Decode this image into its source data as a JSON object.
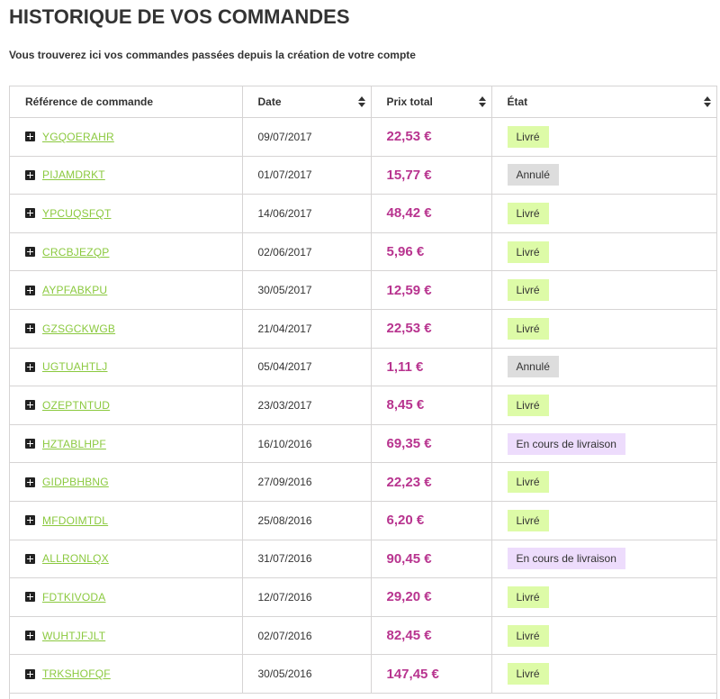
{
  "page": {
    "title": "HISTORIQUE DE VOS COMMANDES",
    "subtitle": "Vous trouverez ici vos commandes passées depuis la création de votre compte"
  },
  "table": {
    "headers": [
      "Référence de commande",
      "Date",
      "Prix total",
      "État"
    ],
    "rows": [
      {
        "ref": "YGQOERAHR",
        "date": "09/07/2017",
        "price": "22,53 €",
        "state": "Livré",
        "state_color": "#ddfba7"
      },
      {
        "ref": "PIJAMDRKT",
        "date": "01/07/2017",
        "price": "15,77 €",
        "state": "Annulé",
        "state_color": "#dddddd"
      },
      {
        "ref": "YPCUQSFQT",
        "date": "14/06/2017",
        "price": "48,42 €",
        "state": "Livré",
        "state_color": "#ddfba7"
      },
      {
        "ref": "CRCBJEZQP",
        "date": "02/06/2017",
        "price": "5,96 €",
        "state": "Livré",
        "state_color": "#ddfba7"
      },
      {
        "ref": "AYPFABKPU",
        "date": "30/05/2017",
        "price": "12,59 €",
        "state": "Livré",
        "state_color": "#ddfba7"
      },
      {
        "ref": "GZSGCKWGB",
        "date": "21/04/2017",
        "price": "22,53 €",
        "state": "Livré",
        "state_color": "#ddfba7"
      },
      {
        "ref": "UGTUAHTLJ",
        "date": "05/04/2017",
        "price": "1,11 €",
        "state": "Annulé",
        "state_color": "#dddddd"
      },
      {
        "ref": "OZEPTNTUD",
        "date": "23/03/2017",
        "price": "8,45 €",
        "state": "Livré",
        "state_color": "#ddfba7"
      },
      {
        "ref": "HZTABLHPF",
        "date": "16/10/2016",
        "price": "69,35 €",
        "state": "En cours de livraison",
        "state_color": "#eddcfc"
      },
      {
        "ref": "GIDPBHBNG",
        "date": "27/09/2016",
        "price": "22,23 €",
        "state": "Livré",
        "state_color": "#ddfba7"
      },
      {
        "ref": "MFDOIMTDL",
        "date": "25/08/2016",
        "price": "6,20 €",
        "state": "Livré",
        "state_color": "#ddfba7"
      },
      {
        "ref": "ALLRONLQX",
        "date": "31/07/2016",
        "price": "90,45 €",
        "state": "En cours de livraison",
        "state_color": "#eddcfc"
      },
      {
        "ref": "FDTKIVODA",
        "date": "12/07/2016",
        "price": "29,20 €",
        "state": "Livré",
        "state_color": "#ddfba7"
      },
      {
        "ref": "WUHTJFJLT",
        "date": "02/07/2016",
        "price": "82,45 €",
        "state": "Livré",
        "state_color": "#ddfba7"
      },
      {
        "ref": "TRKSHOFQF",
        "date": "30/05/2016",
        "price": "147,45 €",
        "state": "Livré",
        "state_color": "#ddfba7"
      }
    ]
  },
  "colors": {
    "link": "#8bc93f",
    "price": "#b8348f",
    "border": "#d6d4d4"
  }
}
